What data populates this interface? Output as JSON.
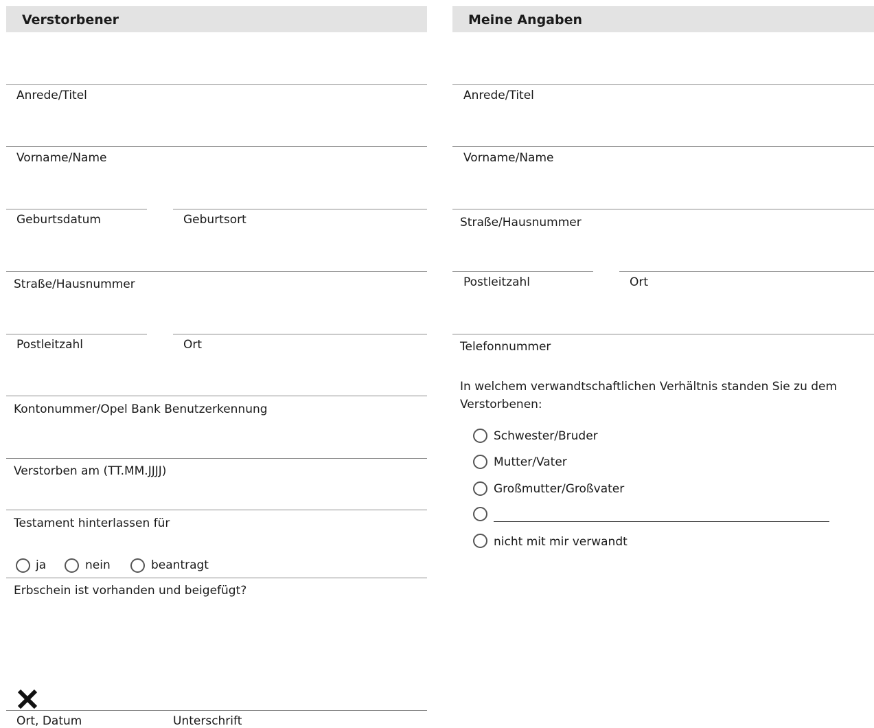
{
  "left": {
    "header": "Verstorbener",
    "fields": {
      "anrede": "Anrede/Titel",
      "vorname": "Vorname/Name",
      "geburtsdatum": "Geburtsdatum",
      "geburtsort": "Geburtsort",
      "strasse": "Straße/Hausnummer",
      "plz": "Postleitzahl",
      "ort": "Ort",
      "konto": "Kontonummer/Opel Bank Benutzerkennung",
      "verstorben_am": "Verstorben am (TT.MM.JJJJ)",
      "testament": "Testament hinterlassen für",
      "erbschein": "Erbschein ist vorhanden und beigefügt?",
      "ort_datum": "Ort, Datum",
      "unterschrift": "Unterschrift"
    },
    "testament_options": [
      "ja",
      "nein",
      "beantragt"
    ]
  },
  "right": {
    "header": "Meine Angaben",
    "fields": {
      "anrede": "Anrede/Titel",
      "vorname": "Vorname/Name",
      "strasse": "Straße/Hausnummer",
      "plz": "Postleitzahl",
      "ort": "Ort",
      "telefon": "Telefonnummer"
    },
    "relationship_question_line1": "In welchem verwandtschaftlichen Verhältnis standen Sie zu dem",
    "relationship_question_line2": "Verstorbenen:",
    "relationship_options": [
      "Schwester/Bruder",
      "Mutter/Vater",
      "Großmutter/Großvater",
      "",
      "nicht mit mir verwandt"
    ]
  },
  "colors": {
    "header_bg": "#e3e3e3",
    "line": "#8a8a8a",
    "text": "#1a1a1a"
  }
}
